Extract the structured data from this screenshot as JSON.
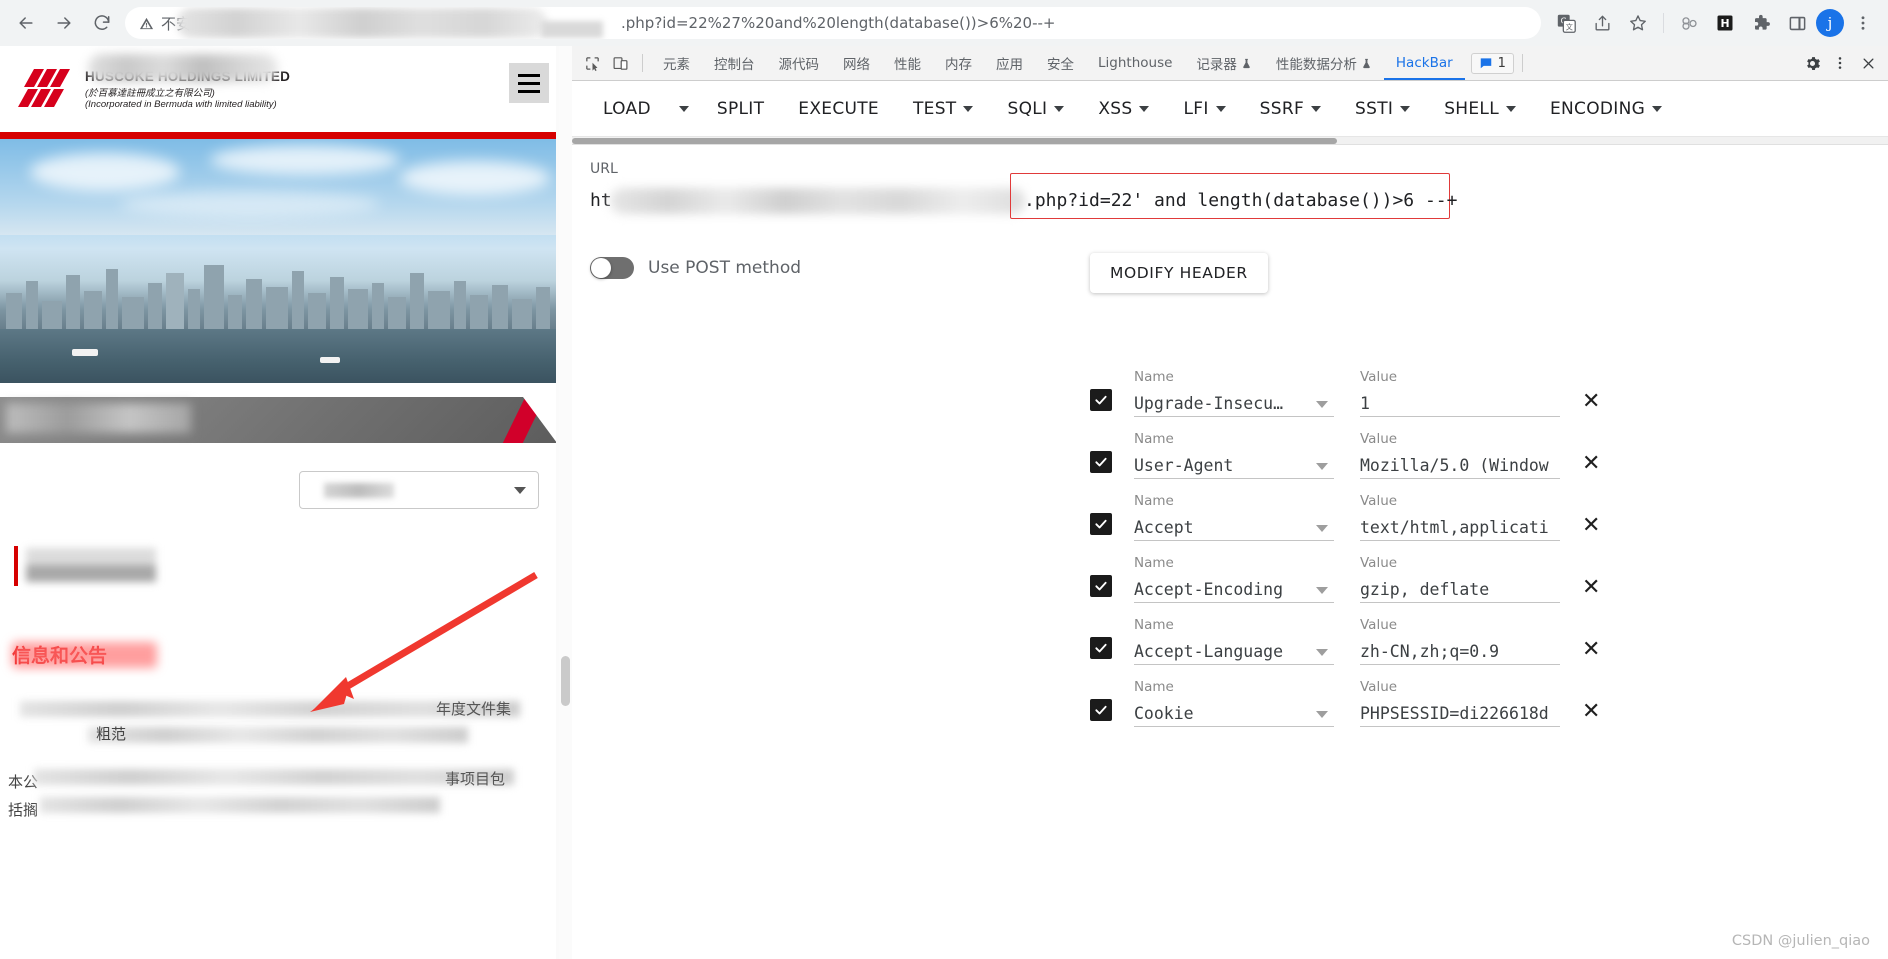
{
  "browser": {
    "back_icon": "arrow-left-icon",
    "forward_icon": "arrow-right-icon",
    "reload_icon": "reload-icon",
    "security_icon": "warning-triangle-icon",
    "security_label": "不安",
    "url_visible": ".php?id=22%27%20and%20length(database())>6%20--+",
    "translate_icon": "google-translate-icon",
    "share_icon": "share-icon",
    "bookmark_icon": "star-icon",
    "extension_chain_icon": "chain-extension-icon",
    "hackbar_ext_icon": "H",
    "puzzle_icon": "extensions-puzzle-icon",
    "sidepanel_icon": "side-panel-icon",
    "profile_initial": "j",
    "menu_icon": "three-dot-menu-icon"
  },
  "page": {
    "logo": {
      "title": "HUSCOKE HOLDINGS LIMITED",
      "sub_zh": "(於百慕達註冊成立之有限公司)",
      "sub_en": "(Incorporated in Bermuda with limited liability)"
    },
    "menu_icon": "hamburger-menu-icon",
    "red_heading": "信息和公告",
    "body_text_1": "粗范",
    "body_text_2a": "本公",
    "body_text_2b": "括搁",
    "body_text_right": "年度文件集",
    "body_text_right2": "事项目包"
  },
  "devtools": {
    "inspect_icon": "inspect-element-icon",
    "device_icon": "device-toolbar-icon",
    "tabs": [
      {
        "label": "元素",
        "active": false
      },
      {
        "label": "控制台",
        "active": false
      },
      {
        "label": "源代码",
        "active": false
      },
      {
        "label": "网络",
        "active": false
      },
      {
        "label": "性能",
        "active": false
      },
      {
        "label": "内存",
        "active": false
      },
      {
        "label": "应用",
        "active": false
      },
      {
        "label": "安全",
        "active": false
      },
      {
        "label": "Lighthouse",
        "active": false
      },
      {
        "label": "记录器",
        "active": false,
        "badge_icon": "flask-icon"
      },
      {
        "label": "性能数据分析",
        "active": false,
        "badge_icon": "flask-icon"
      },
      {
        "label": "HackBar",
        "active": true
      }
    ],
    "message_badge": {
      "icon": "message-icon",
      "count": "1"
    },
    "settings_icon": "gear-icon",
    "more_icon": "three-dot-menu-icon",
    "close_icon": "close-icon"
  },
  "hackbar": {
    "toolbar": [
      {
        "label": "LOAD",
        "has_caret": false,
        "separate_caret": true
      },
      {
        "label": "SPLIT",
        "has_caret": false
      },
      {
        "label": "EXECUTE",
        "has_caret": false
      },
      {
        "label": "TEST",
        "has_caret": true
      },
      {
        "label": "SQLI",
        "has_caret": true
      },
      {
        "label": "XSS",
        "has_caret": true
      },
      {
        "label": "LFI",
        "has_caret": true
      },
      {
        "label": "SSRF",
        "has_caret": true
      },
      {
        "label": "SSTI",
        "has_caret": true
      },
      {
        "label": "SHELL",
        "has_caret": true
      },
      {
        "label": "ENCODING",
        "has_caret": true
      }
    ],
    "url_label": "URL",
    "url_prefix": "ht",
    "url_payload": ".php?id=22' and length(database())>6 --+",
    "post_toggle_label": "Use POST method",
    "post_toggle_on": false,
    "modify_header_label": "MODIFY HEADER",
    "name_caption": "Name",
    "value_caption": "Value",
    "remove_icon": "close-x-icon",
    "headers": [
      {
        "enabled": true,
        "name": "Upgrade-Insecu…",
        "value": "1"
      },
      {
        "enabled": true,
        "name": "User-Agent",
        "value": "Mozilla/5.0 (Window"
      },
      {
        "enabled": true,
        "name": "Accept",
        "value": "text/html,applicati"
      },
      {
        "enabled": true,
        "name": "Accept-Encoding",
        "value": "gzip, deflate"
      },
      {
        "enabled": true,
        "name": "Accept-Language",
        "value": "zh-CN,zh;q=0.9"
      },
      {
        "enabled": true,
        "name": "Cookie",
        "value": "PHPSESSID=di226618d"
      }
    ]
  },
  "watermark": "CSDN @julien_qiao",
  "colors": {
    "accent_blue": "#1a73e8",
    "brand_red": "#d60000",
    "highlight_red": "#e03a3a"
  }
}
